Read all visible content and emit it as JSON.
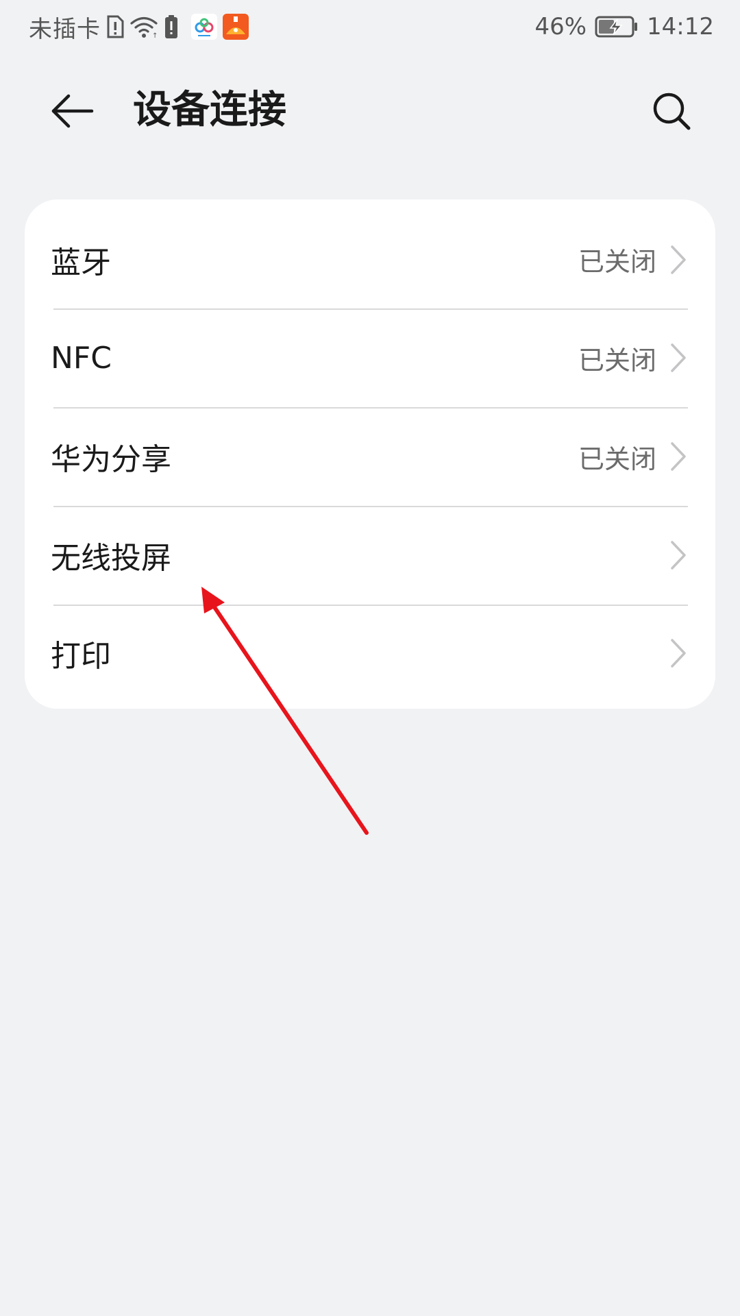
{
  "status_bar": {
    "carrier": "未插卡",
    "battery_percent": "46%",
    "time": "14:12",
    "icons": [
      "sim-error-icon",
      "wifi-icon",
      "battery-alert-icon",
      "cloud-app-icon",
      "orange-app-icon",
      "battery-charging-icon"
    ]
  },
  "header": {
    "title": "设备连接",
    "back_icon": "back-arrow-icon",
    "search_icon": "search-icon"
  },
  "settings": {
    "items": [
      {
        "label": "蓝牙",
        "value": "已关闭"
      },
      {
        "label": "NFC",
        "value": "已关闭"
      },
      {
        "label": "华为分享",
        "value": "已关闭"
      },
      {
        "label": "无线投屏",
        "value": ""
      },
      {
        "label": "打印",
        "value": ""
      }
    ]
  },
  "colors": {
    "background": "#f1f2f4",
    "card": "#ffffff",
    "annotation_arrow": "#e8141c"
  }
}
